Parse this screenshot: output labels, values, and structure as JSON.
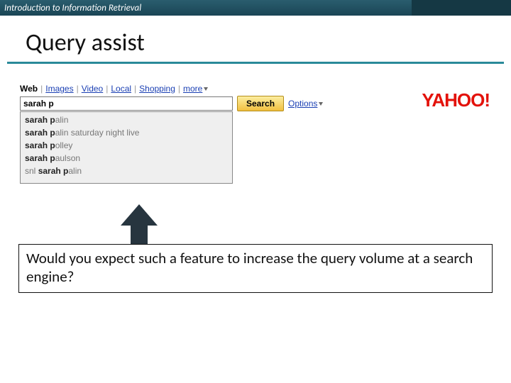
{
  "header": {
    "course": "Introduction to Information Retrieval"
  },
  "title": "Query assist",
  "tabs": {
    "web": "Web",
    "images": "Images",
    "video": "Video",
    "local": "Local",
    "shopping": "Shopping",
    "more": "more"
  },
  "search": {
    "value": "sarah p",
    "button": "Search",
    "options": "Options"
  },
  "suggestions": [
    {
      "pre": "",
      "bold": "sarah p",
      "post": "alin"
    },
    {
      "pre": "",
      "bold": "sarah p",
      "post": "alin saturday night live"
    },
    {
      "pre": "",
      "bold": "sarah p",
      "post": "olley"
    },
    {
      "pre": "",
      "bold": "sarah p",
      "post": "aulson"
    },
    {
      "pre": "snl ",
      "bold": "sarah p",
      "post": "alin"
    }
  ],
  "logo": {
    "main": "YAHOO",
    "excl": "!"
  },
  "question": "Would you expect such a feature to increase the query volume at a search engine?"
}
